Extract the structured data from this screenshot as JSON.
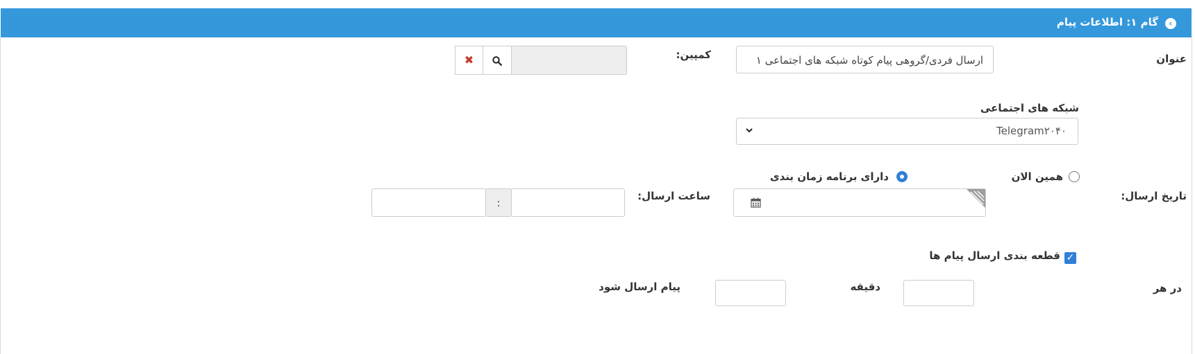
{
  "step_header": {
    "title": "گام ۱: اطلاعات پیام",
    "icon": "chevron-right-circle-icon",
    "color": "#3498db"
  },
  "subject": {
    "label": "عنوان",
    "value": "ارسال فردی/گروهی پیام کوتاه شبکه های اجتماعی ۱"
  },
  "campaign": {
    "label": "کمپین:",
    "value": "",
    "search_icon": "search-icon",
    "clear_icon": "close-icon"
  },
  "social_network": {
    "label": "شبکه های اجتماعی",
    "selected": "Telegram۲۰۴۰"
  },
  "send_mode": {
    "now_label": "همین الان",
    "scheduled_label": "دارای برنامه زمان بندی",
    "selected": "scheduled"
  },
  "send_date": {
    "label": "تاریخ ارسال:",
    "value": "",
    "calendar_icon": "calendar-icon"
  },
  "send_time": {
    "label": "ساعت ارسال:",
    "separator": ":",
    "hour": "",
    "minute": ""
  },
  "segmentation": {
    "label": "قطعه بندی ارسال پیام ها",
    "checked": true
  },
  "interval": {
    "every_label": "در هر",
    "minute_label": "دقیقه",
    "send_label": "پیام ارسال شود",
    "minutes_value": "",
    "count_value": ""
  }
}
